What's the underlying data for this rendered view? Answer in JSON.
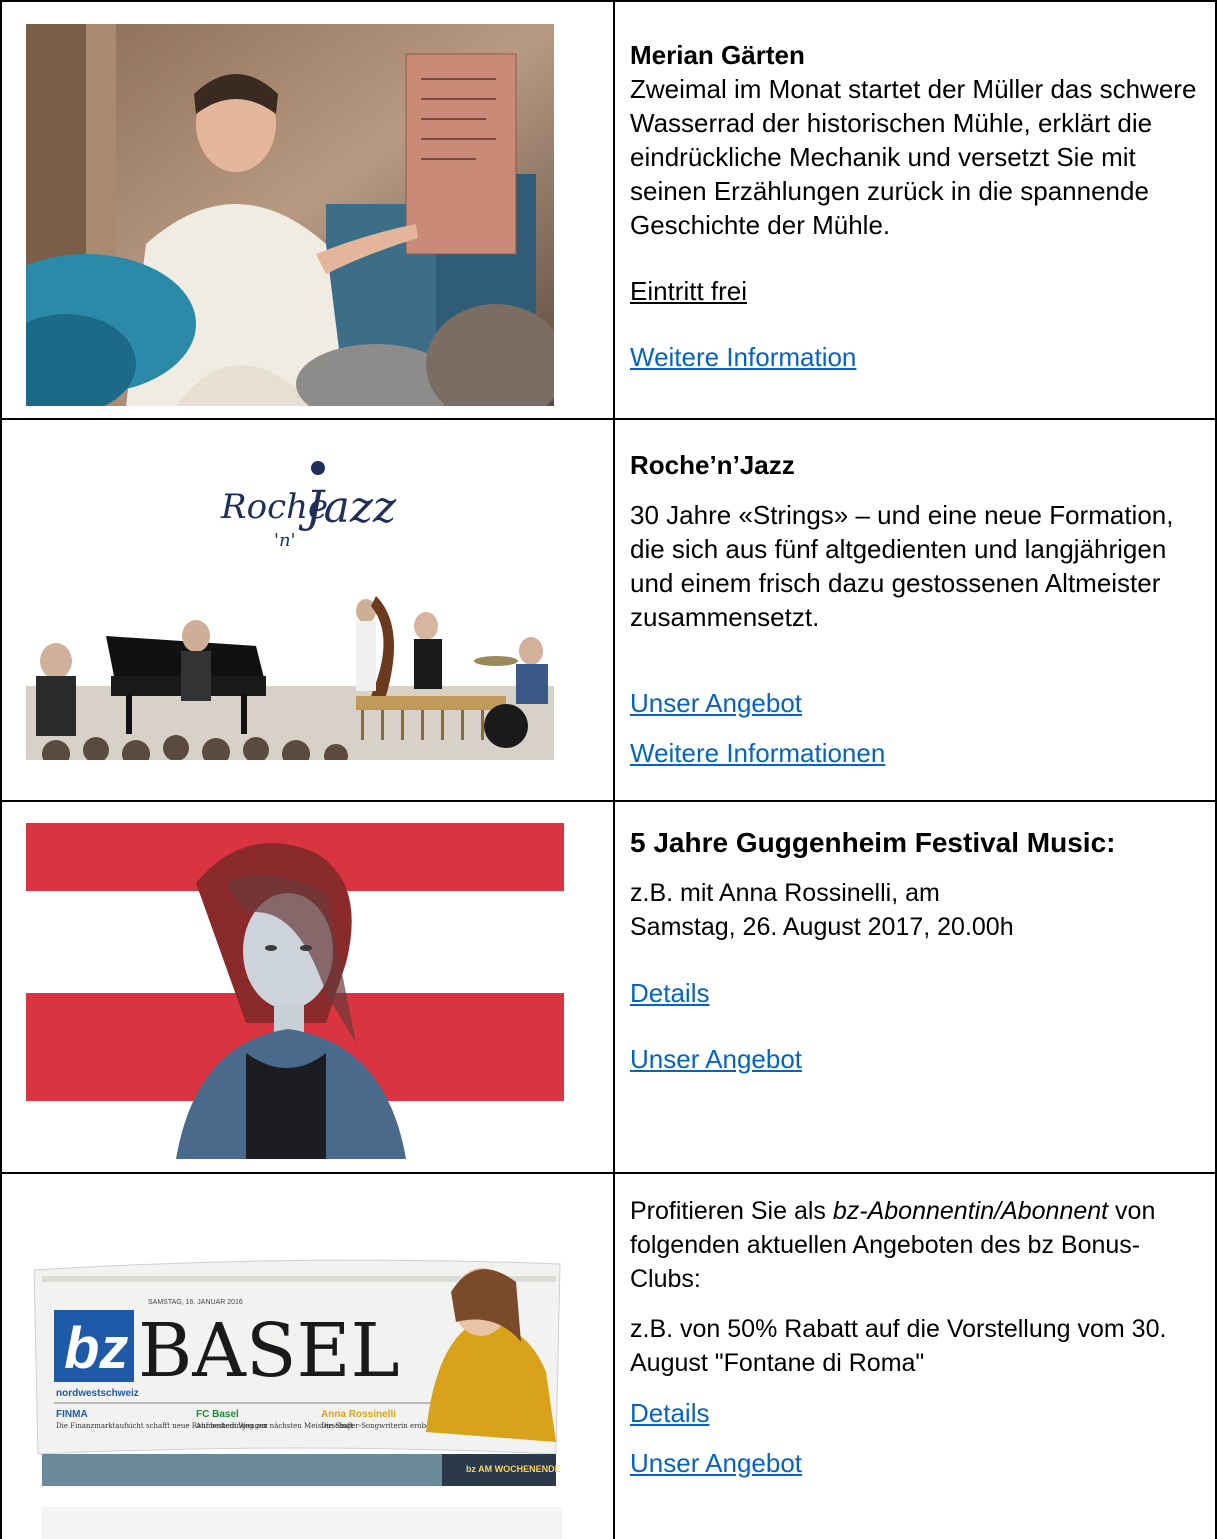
{
  "rows": [
    {
      "title": "Merian Gärten",
      "text": "Zweimal im Monat startet der Müller das schwere Wasserrad der historischen Mühle, erklärt die eindrückliche Mechanik und versetzt Sie mit seinen Erzählungen zurück in die spannende Geschichte der Mühle.",
      "note": "Eintritt frei",
      "link1": "Weitere Information"
    },
    {
      "title": "Roche’n’Jazz",
      "text": "30 Jahre «Strings» – und eine neue Formation, die sich aus fünf altgedienten und langjährigen und einem frisch dazu gestossenen Altmeister zusammensetzt.",
      "link1": "Unser Angebot",
      "link2": "Weitere Informationen",
      "logo": "Roche 'n' Jazz"
    },
    {
      "title": "5 Jahre Guggenheim Festival Music:",
      "text1": "z.B. mit Anna Rossinelli, am",
      "text2": "Samstag, 26. August 2017, 20.00h",
      "link1": "Details",
      "link2": "Unser Angebot"
    },
    {
      "text_a": "Profitieren Sie als ",
      "text_em": "bz-Abonnentin/Abonnent",
      "text_b": " von folgenden aktuellen Angeboten des bz Bonus-Clubs:",
      "text2": "z.B. von 50% Rabatt auf die Vorstellung vom 30. August \"Fontane di Roma\"",
      "link1": "Details",
      "link2": "Unser Angebot",
      "paper": {
        "logo": "bz",
        "name": "BASEL",
        "region": "nordwestschweiz",
        "date": "SAMSTAG, 16. JANUAR 2016",
        "teaser1_title": "FINMA",
        "teaser1_text": "Die Finanzmarktaufsicht schafft neue Rahmenbedingungen",
        "teaser2_title": "FC Basel",
        "teaser2_text": "Auf bestem Weg zur nächsten Meisterschaft",
        "teaser3_title": "Anna Rossinelli",
        "teaser3_text": "Die Singer-Songwriterin erobert die Musikwelt",
        "bottom": "bz AM WOCHENENDE"
      }
    }
  ]
}
